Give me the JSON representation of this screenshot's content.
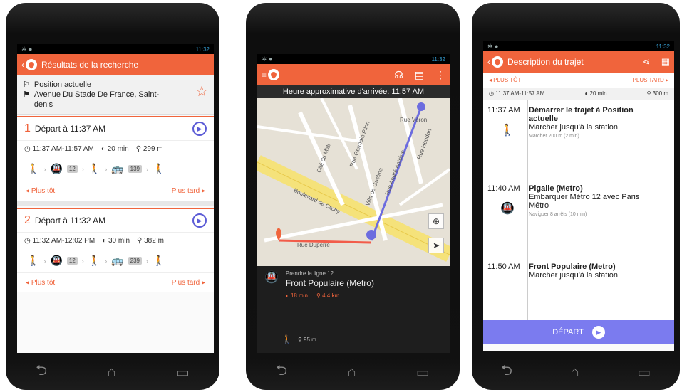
{
  "status": {
    "time": "11:32"
  },
  "phone1": {
    "title": "Résultats de la recherche",
    "origin": "Position actuelle",
    "destination": "Avenue Du Stade De France, Saint-denis",
    "routes": [
      {
        "num": "1",
        "depart": "Départ à 11:37 AM",
        "times": "11:37 AM-11:57 AM",
        "duration": "20 min",
        "distance": "299 m",
        "metro_line": "12",
        "bus_line": "139",
        "earlier": "Plus tôt",
        "later": "Plus tard"
      },
      {
        "num": "2",
        "depart": "Départ à 11:32 AM",
        "times": "11:32 AM-12:02 PM",
        "duration": "30 min",
        "distance": "382 m",
        "metro_line": "12",
        "bus_line": "239",
        "earlier": "Plus tôt",
        "later": "Plus tard"
      }
    ]
  },
  "phone2": {
    "eta": "Heure approximative d'arrivée: 11:57 AM",
    "streets": [
      "Boulevard de Clichy",
      "Rue Dupérré",
      "Rue Germain Pilon",
      "Rue André Antoine",
      "Rue Houdon",
      "Villa de Guelma",
      "Cité du Midi",
      "Rue Véron"
    ],
    "step_small": "Prendre la ligne 12",
    "step_title": "Front Populaire (Metro)",
    "step_time": "18 min",
    "step_dist": "4.4 km",
    "walk_dist": "95 m"
  },
  "phone3": {
    "title": "Description du trajet",
    "earlier": "PLUS TÔT",
    "later": "PLUS TARD",
    "times": "11:37 AM-11:57 AM",
    "duration": "20 min",
    "distance": "300 m",
    "steps": [
      {
        "time": "11:37 AM",
        "title": "Démarrer le trajet à Position actuelle",
        "desc": "Marcher jusqu'à la station",
        "sub": "Marcher 200 m (2 min)"
      },
      {
        "time": "11:40 AM",
        "title": "Pigalle (Metro)",
        "desc": "Embarquer Métro 12 avec Paris Métro",
        "sub": "Naviguer 8 arrêts (10 min)"
      },
      {
        "time": "11:50 AM",
        "title": "Front Populaire (Metro)",
        "desc": "Marcher jusqu'à la station",
        "sub": ""
      }
    ],
    "depart_label": "DÉPART"
  },
  "colors": {
    "accent": "#f0643c",
    "primary": "#5b5bd6",
    "depart": "#7b7bef"
  }
}
